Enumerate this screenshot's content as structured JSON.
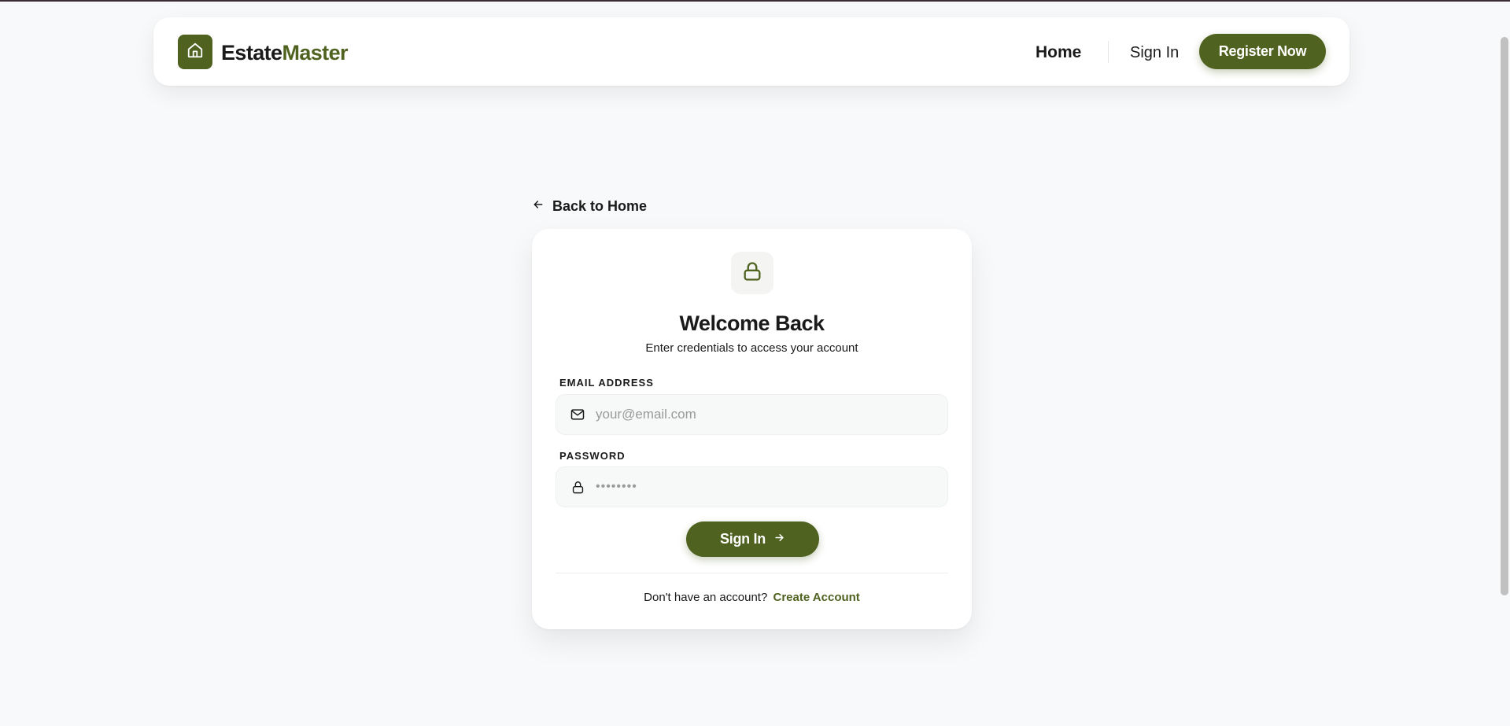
{
  "header": {
    "brand_part1": "Estate",
    "brand_part2": "Master",
    "logo_icon": "home-icon",
    "nav": {
      "home": "Home",
      "sign_in": "Sign In",
      "register": "Register Now"
    }
  },
  "back_link": {
    "label": "Back to Home",
    "icon": "arrow-left-icon"
  },
  "login_card": {
    "icon": "lock-icon",
    "title": "Welcome Back",
    "subtitle": "Enter credentials to access your account",
    "email": {
      "label": "EMAIL ADDRESS",
      "placeholder": "your@email.com",
      "value": "",
      "icon": "mail-icon"
    },
    "password": {
      "label": "PASSWORD",
      "placeholder": "••••••••",
      "value": "",
      "icon": "lock-icon"
    },
    "submit": {
      "label": "Sign In",
      "icon": "arrow-right-icon"
    },
    "footer": {
      "prompt": "Don't have an account?",
      "link": "Create Account"
    }
  },
  "colors": {
    "accent": "#4f6220",
    "background": "#f8f9fa",
    "card": "#ffffff",
    "text": "#1a1a1a"
  }
}
